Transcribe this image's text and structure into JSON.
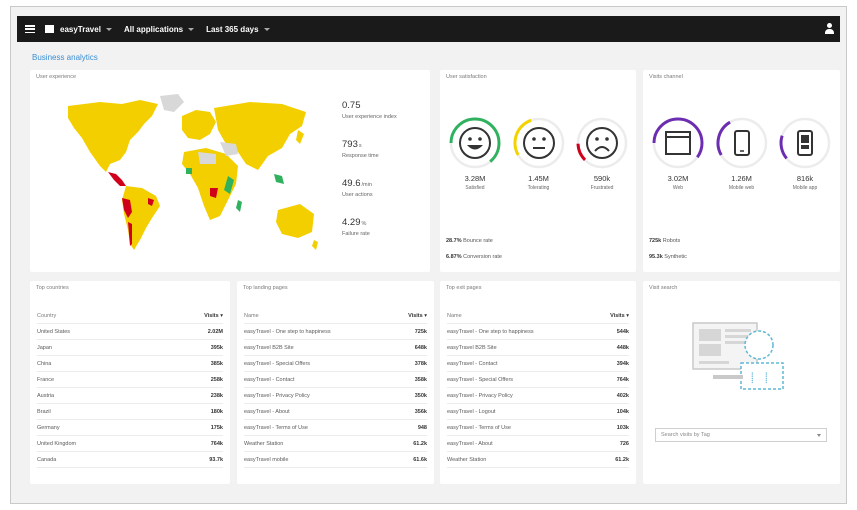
{
  "topbar": {
    "app_name": "easyTravel",
    "apps_filter": "All applications",
    "timeframe": "Last 365 days"
  },
  "page_title": "Business analytics",
  "colors": {
    "accent": "#3b8fd4",
    "satisfied": "#2fb15e",
    "tolerating": "#f2d300",
    "frustrated": "#d0021b",
    "device": "#6d2db0",
    "map_yellow": "#f3cf00",
    "map_grey": "#d8d8d8"
  },
  "ux_tile": {
    "title": "User experience",
    "kpis": [
      {
        "value": "0.75",
        "unit": "",
        "label": "User experience index"
      },
      {
        "value": "793",
        "unit": "s",
        "label": "Response time"
      },
      {
        "value": "49.6",
        "unit": "/min",
        "label": "User actions"
      },
      {
        "value": "4.29",
        "unit": "%",
        "label": "Failure rate"
      }
    ]
  },
  "satisfaction_tile": {
    "title": "User satisfaction",
    "gauges": [
      {
        "icon": "happy-face-icon",
        "value": "3.28M",
        "label": "Satisfied",
        "fraction": 0.64
      },
      {
        "icon": "neutral-face-icon",
        "value": "1.45M",
        "label": "Tolerating",
        "fraction": 0.28
      },
      {
        "icon": "sad-face-icon",
        "value": "590k",
        "label": "Frustrated",
        "fraction": 0.12
      }
    ],
    "footer": [
      {
        "value": "28.7%",
        "label": "Bounce rate"
      },
      {
        "value": "6.87%",
        "label": "Conversion rate"
      }
    ]
  },
  "devices_tile": {
    "title": "Visits channel",
    "gauges": [
      {
        "icon": "desktop-browser-icon",
        "value": "3.02M",
        "label": "Web",
        "fraction": 0.6
      },
      {
        "icon": "mobile-web-icon",
        "value": "1.26M",
        "label": "Mobile web",
        "fraction": 0.25
      },
      {
        "icon": "mobile-app-icon",
        "value": "816k",
        "label": "Mobile app",
        "fraction": 0.16
      }
    ],
    "footer": [
      {
        "value": "725k",
        "label": "Robots"
      },
      {
        "value": "95.3k",
        "label": "Synthetic"
      }
    ]
  },
  "countries_tile": {
    "title": "Top countries",
    "col_name": "Country",
    "col_value": "Visits",
    "rows": [
      {
        "name": "United States",
        "value": "2.02M"
      },
      {
        "name": "Japan",
        "value": "395k"
      },
      {
        "name": "China",
        "value": "385k"
      },
      {
        "name": "France",
        "value": "258k"
      },
      {
        "name": "Austria",
        "value": "238k"
      },
      {
        "name": "Brazil",
        "value": "180k"
      },
      {
        "name": "Germany",
        "value": "175k"
      },
      {
        "name": "United Kingdom",
        "value": "764k"
      },
      {
        "name": "Canada",
        "value": "93.7k"
      }
    ]
  },
  "landing_tile": {
    "title": "Top landing pages",
    "col_name": "Name",
    "col_value": "Visits",
    "rows": [
      {
        "name": "easyTravel - One step to happiness",
        "value": "725k"
      },
      {
        "name": "easyTravel B2B Site",
        "value": "648k"
      },
      {
        "name": "easyTravel - Special Offers",
        "value": "378k"
      },
      {
        "name": "easyTravel - Contact",
        "value": "358k"
      },
      {
        "name": "easyTravel - Privacy Policy",
        "value": "350k"
      },
      {
        "name": "easyTravel - About",
        "value": "356k"
      },
      {
        "name": "easyTravel - Terms of Use",
        "value": "948"
      },
      {
        "name": "Weather Station",
        "value": "61.2k"
      },
      {
        "name": "easyTravel mobile",
        "value": "61.6k"
      }
    ]
  },
  "exit_tile": {
    "title": "Top exit pages",
    "col_name": "Name",
    "col_value": "Visits",
    "rows": [
      {
        "name": "easyTravel - One step to happiness",
        "value": "544k"
      },
      {
        "name": "easyTravel B2B Site",
        "value": "448k"
      },
      {
        "name": "easyTravel - Contact",
        "value": "394k"
      },
      {
        "name": "easyTravel - Special Offers",
        "value": "764k"
      },
      {
        "name": "easyTravel - Privacy Policy",
        "value": "402k"
      },
      {
        "name": "easyTravel - Logout",
        "value": "104k"
      },
      {
        "name": "easyTravel - Terms of Use",
        "value": "103k"
      },
      {
        "name": "easyTravel - About",
        "value": "726"
      },
      {
        "name": "Weather Station",
        "value": "61.2k"
      }
    ]
  },
  "search_tile": {
    "title": "Visit search",
    "placeholder": "Search visits by Tag"
  }
}
